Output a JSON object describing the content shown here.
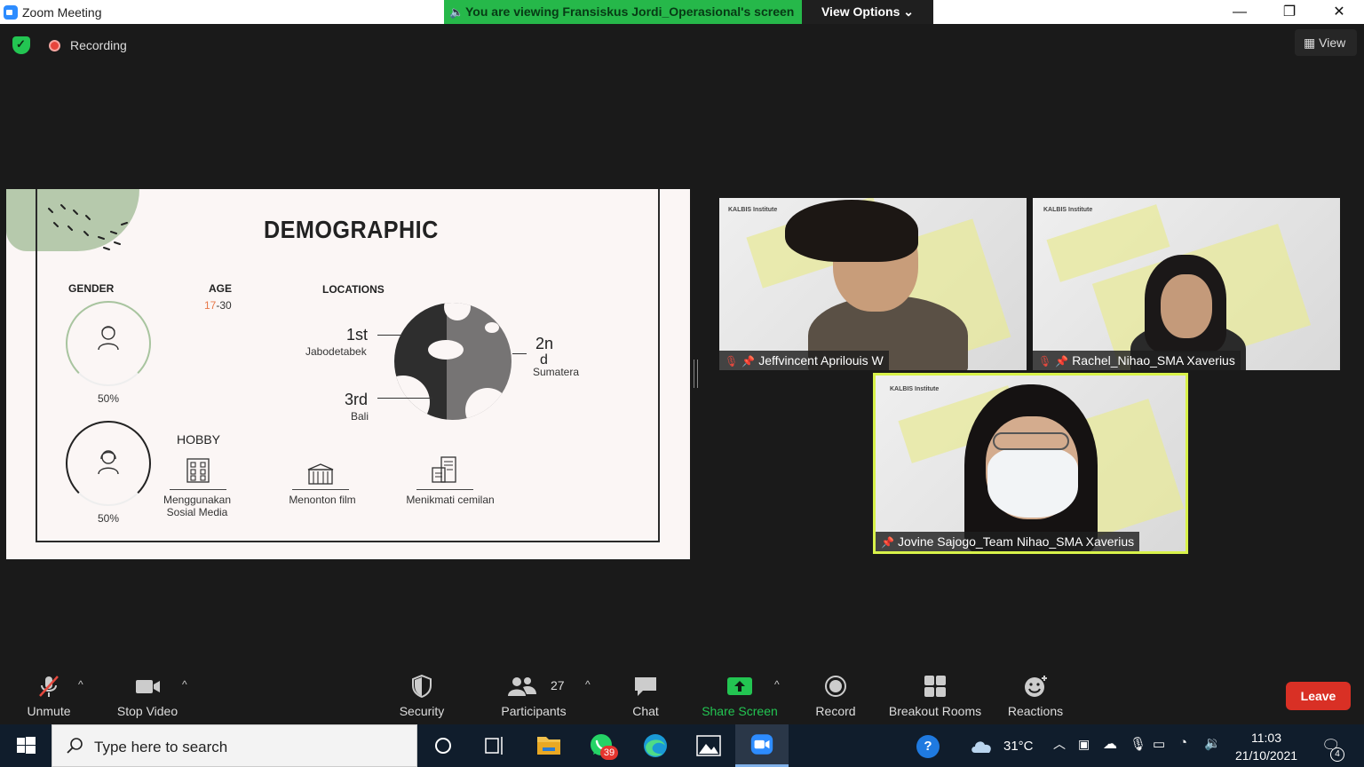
{
  "window": {
    "title": "Zoom Meeting",
    "share_banner": "You are viewing Fransiskus Jordi_Operasional's screen",
    "view_options_label": "View Options",
    "minimize_glyph": "—",
    "restore_glyph": "❐",
    "close_glyph": "✕"
  },
  "status": {
    "recording_label": "Recording",
    "view_label": "View"
  },
  "slide": {
    "title": "DEMOGRAPHIC",
    "gender_label": "GENDER",
    "age_label": "AGE",
    "age_value_min": "17",
    "age_value_sep": "-30",
    "locations_label": "LOCATIONS",
    "male_percent": "50%",
    "female_percent": "50%",
    "locations": {
      "first_rank": "1st",
      "first_place": "Jabodetabek",
      "second_rank_a": "2n",
      "second_rank_b": "d",
      "second_place": "Sumatera",
      "third_rank": "3rd",
      "third_place": "Bali"
    },
    "hobby_label": "HOBBY",
    "hobbies": [
      {
        "line1": "Menggunakan",
        "line2": "Sosial Media"
      },
      {
        "line1": "Menonton film",
        "line2": ""
      },
      {
        "line1": "Menikmati cemilan",
        "line2": ""
      }
    ]
  },
  "participants_video": [
    {
      "name": "Jeffvincent Aprilouis W",
      "muted": true
    },
    {
      "name": "Rachel_Nihao_SMA Xaverius",
      "muted": true
    },
    {
      "name": "Jovine Sajogo_Team Nihao_SMA Xaverius",
      "muted": false,
      "speaking": true
    }
  ],
  "background_brand": "KALBIS Institute",
  "toolbar": {
    "unmute_label": "Unmute",
    "stop_video_label": "Stop Video",
    "security_label": "Security",
    "participants_label": "Participants",
    "participants_count": "27",
    "chat_label": "Chat",
    "share_screen_label": "Share Screen",
    "record_label": "Record",
    "breakout_label": "Breakout Rooms",
    "reactions_label": "Reactions",
    "leave_label": "Leave",
    "caret": "^"
  },
  "taskbar": {
    "search_placeholder": "Type here to search",
    "whatsapp_badge": "39",
    "temperature": "31°C",
    "time": "11:03",
    "date": "21/10/2021",
    "notifications_count": "4",
    "help_glyph": "?"
  },
  "colors": {
    "share_green": "#26b84a",
    "leave_red": "#d93025",
    "active_speaker": "#d8f24a",
    "share_screen_icon": "#23c552"
  }
}
